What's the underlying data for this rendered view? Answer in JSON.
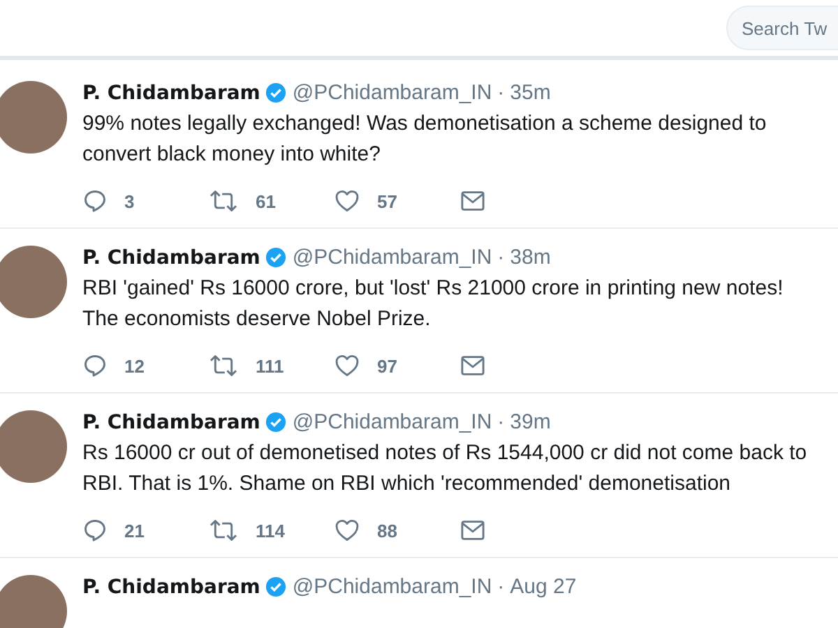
{
  "search": {
    "placeholder": "Search Tw"
  },
  "separator": "·",
  "tweets": [
    {
      "name": "P. Chidambaram",
      "verified": true,
      "handle": "@PChidambaram_IN",
      "time": "35m",
      "text": "99% notes legally exchanged! Was demonetisation a scheme designed to convert black money into white?",
      "replies": "3",
      "retweets": "61",
      "likes": "57"
    },
    {
      "name": "P. Chidambaram",
      "verified": true,
      "handle": "@PChidambaram_IN",
      "time": "38m",
      "text": "RBI 'gained' Rs 16000 crore, but 'lost' Rs 21000 crore in printing new notes! The economists deserve Nobel Prize.",
      "replies": "12",
      "retweets": "111",
      "likes": "97"
    },
    {
      "name": "P. Chidambaram",
      "verified": true,
      "handle": "@PChidambaram_IN",
      "time": "39m",
      "text": "Rs 16000 cr out of demonetised notes of Rs 1544,000 cr did not come back to RBI. That is 1%. Shame on RBI which 'recommended' demonetisation",
      "replies": "21",
      "retweets": "114",
      "likes": "88"
    },
    {
      "name": "P. Chidambaram",
      "verified": true,
      "handle": "@PChidambaram_IN",
      "time": "Aug 27"
    }
  ]
}
